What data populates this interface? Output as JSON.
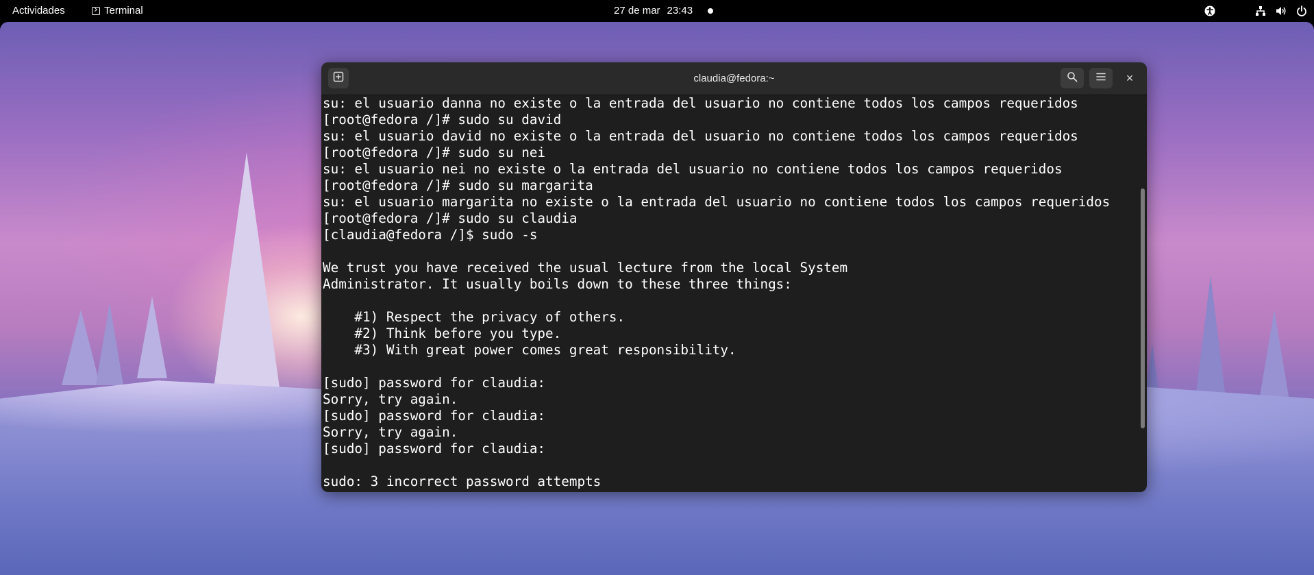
{
  "topbar": {
    "activities": "Actividades",
    "app_name": "Terminal",
    "date": "27 de mar",
    "time": "23:43",
    "tray_icons": [
      "accessibility-icon",
      "network-icon",
      "volume-icon",
      "power-icon"
    ]
  },
  "terminal": {
    "title": "claudia@fedora:~",
    "buttons": {
      "new_tab": "new-tab-icon",
      "search": "search-icon",
      "menu": "hamburger-menu-icon",
      "close": "×"
    },
    "lines": [
      "su: el usuario danna no existe o la entrada del usuario no contiene todos los campos requeridos",
      "[root@fedora /]# sudo su david",
      "su: el usuario david no existe o la entrada del usuario no contiene todos los campos requeridos",
      "[root@fedora /]# sudo su nei",
      "su: el usuario nei no existe o la entrada del usuario no contiene todos los campos requeridos",
      "[root@fedora /]# sudo su margarita",
      "su: el usuario margarita no existe o la entrada del usuario no contiene todos los campos requeridos",
      "[root@fedora /]# sudo su claudia",
      "[claudia@fedora /]$ sudo -s",
      "",
      "We trust you have received the usual lecture from the local System",
      "Administrator. It usually boils down to these three things:",
      "",
      "    #1) Respect the privacy of others.",
      "    #2) Think before you type.",
      "    #3) With great power comes great responsibility.",
      "",
      "[sudo] password for claudia:",
      "Sorry, try again.",
      "[sudo] password for claudia:",
      "Sorry, try again.",
      "[sudo] password for claudia:",
      "",
      "sudo: 3 incorrect password attempts"
    ]
  },
  "colors": {
    "topbar_bg": "#000000",
    "terminal_bg": "#1e1e1e",
    "headerbar_bg": "#2a2a2a",
    "terminal_text": "#ffffff"
  }
}
